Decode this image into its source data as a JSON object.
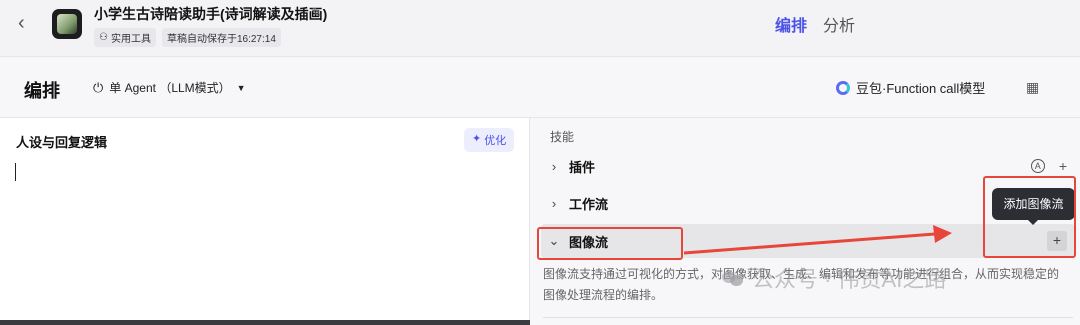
{
  "header": {
    "back_icon": "chevron-left-icon",
    "app_title": "小学生古诗陪读助手(诗词解读及插画)",
    "tags": [
      "实用工具",
      "草稿自动保存于16:27:14"
    ],
    "tabs": [
      {
        "label": "编排",
        "active": true
      },
      {
        "label": "分析",
        "active": false
      }
    ]
  },
  "toolbar": {
    "section_title": "编排",
    "mode_label": "单 Agent （LLM模式）",
    "model_label": "豆包·Function call模型"
  },
  "persona": {
    "title": "人设与回复逻辑",
    "optimize_label": "优化"
  },
  "skills": {
    "title": "技能",
    "items": [
      {
        "label": "插件"
      },
      {
        "label": "工作流"
      },
      {
        "label": "图像流"
      }
    ],
    "image_flow_desc": "图像流支持通过可视化的方式，对图像获取、生成、编辑和发布等功能进行组合，从而实现稳定的图像处理流程的编排。",
    "tooltip": "添加图像流"
  },
  "watermark": "公众号 · 伟贯AI之路",
  "colors": {
    "accent": "#4d53e8",
    "annotation": "#e7463a"
  }
}
